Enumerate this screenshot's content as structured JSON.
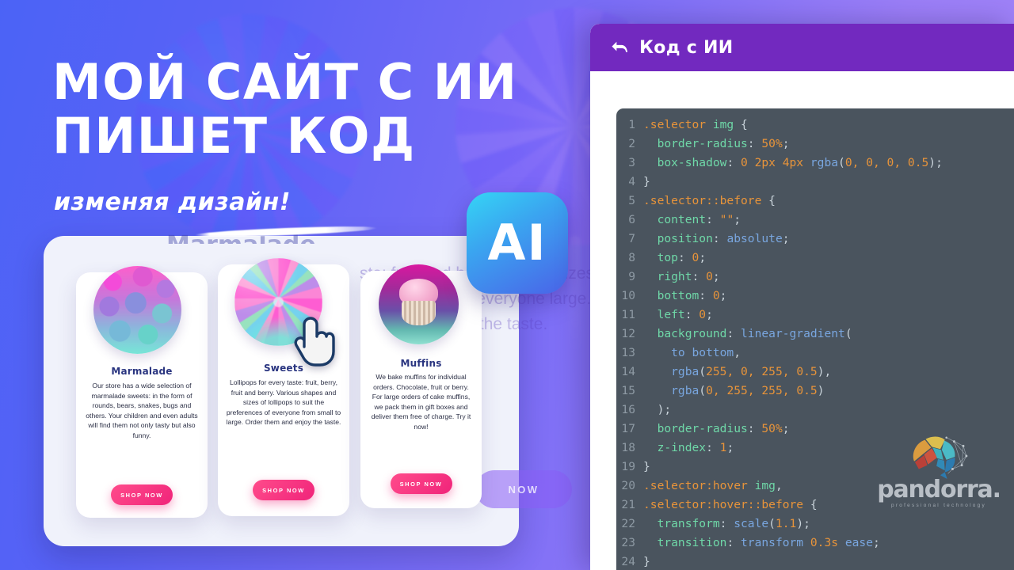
{
  "headline": {
    "line1": "МОЙ САЙТ С ИИ",
    "line2": "ПИШЕТ КОД",
    "subline": "изменяя дизайн!"
  },
  "ai_badge": {
    "label": "AI"
  },
  "ghost": {
    "title": "Marmalade",
    "text": "ste: fruit and berry. es and sizes of to suit the of everyone large. Order joy the taste.",
    "button": "NOW"
  },
  "cards": [
    {
      "title": "Marmalade",
      "body": "Our store has a wide selection of marmalade sweets: in the form of rounds, bears, snakes, bugs and others. Your children and even adults will find them not only tasty but also funny.",
      "button": "SHOP NOW",
      "thumb": "marmalade-photo"
    },
    {
      "title": "Sweets",
      "body": "Lollipops for every taste: fruit, berry, fruit and berry. Various shapes and sizes of lollipops to suit the preferences of everyone from small to large. Order them and enjoy the taste.",
      "button": "SHOP NOW",
      "thumb": "lollipop-photo"
    },
    {
      "title": "Muffins",
      "body": "We bake muffins for individual orders. Chocolate, fruit or berry. For large orders of cake muffins, we pack them in gift boxes and deliver them free of charge. Try it now!",
      "button": "SHOP NOW",
      "thumb": "muffin-photo"
    }
  ],
  "code_panel": {
    "header_title": "Код с ИИ",
    "back_icon": "back-arrow-icon",
    "lines": [
      {
        "n": "1",
        "parts": [
          {
            "t": ".selector",
            "c": "tok-sel"
          },
          {
            "t": " img",
            "c": "tok-prop"
          },
          {
            "t": " {",
            "c": "tok-punc"
          }
        ]
      },
      {
        "n": "2",
        "parts": [
          {
            "t": "  border-radius",
            "c": "tok-prop"
          },
          {
            "t": ": ",
            "c": "tok-punc"
          },
          {
            "t": "50%",
            "c": "tok-num"
          },
          {
            "t": ";",
            "c": "tok-punc"
          }
        ]
      },
      {
        "n": "3",
        "parts": [
          {
            "t": "  box-shadow",
            "c": "tok-prop"
          },
          {
            "t": ": ",
            "c": "tok-punc"
          },
          {
            "t": "0 2px 4px ",
            "c": "tok-num"
          },
          {
            "t": "rgba",
            "c": "tok-fn"
          },
          {
            "t": "(",
            "c": "tok-punc"
          },
          {
            "t": "0, 0, 0, 0.5",
            "c": "tok-num"
          },
          {
            "t": ");",
            "c": "tok-punc"
          }
        ]
      },
      {
        "n": "4",
        "parts": [
          {
            "t": "}",
            "c": "tok-punc"
          }
        ]
      },
      {
        "n": "5",
        "parts": [
          {
            "t": ".selector",
            "c": "tok-sel"
          },
          {
            "t": "::before",
            "c": "tok-sel"
          },
          {
            "t": " {",
            "c": "tok-punc"
          }
        ]
      },
      {
        "n": "6",
        "parts": [
          {
            "t": "  content",
            "c": "tok-prop"
          },
          {
            "t": ": ",
            "c": "tok-punc"
          },
          {
            "t": "\"\"",
            "c": "tok-str"
          },
          {
            "t": ";",
            "c": "tok-punc"
          }
        ]
      },
      {
        "n": "7",
        "parts": [
          {
            "t": "  position",
            "c": "tok-prop"
          },
          {
            "t": ": ",
            "c": "tok-punc"
          },
          {
            "t": "absolute",
            "c": "tok-kw"
          },
          {
            "t": ";",
            "c": "tok-punc"
          }
        ]
      },
      {
        "n": "8",
        "parts": [
          {
            "t": "  top",
            "c": "tok-prop"
          },
          {
            "t": ": ",
            "c": "tok-punc"
          },
          {
            "t": "0",
            "c": "tok-num"
          },
          {
            "t": ";",
            "c": "tok-punc"
          }
        ]
      },
      {
        "n": "9",
        "parts": [
          {
            "t": "  right",
            "c": "tok-prop"
          },
          {
            "t": ": ",
            "c": "tok-punc"
          },
          {
            "t": "0",
            "c": "tok-num"
          },
          {
            "t": ";",
            "c": "tok-punc"
          }
        ]
      },
      {
        "n": "10",
        "parts": [
          {
            "t": "  bottom",
            "c": "tok-prop"
          },
          {
            "t": ": ",
            "c": "tok-punc"
          },
          {
            "t": "0",
            "c": "tok-num"
          },
          {
            "t": ";",
            "c": "tok-punc"
          }
        ]
      },
      {
        "n": "11",
        "parts": [
          {
            "t": "  left",
            "c": "tok-prop"
          },
          {
            "t": ": ",
            "c": "tok-punc"
          },
          {
            "t": "0",
            "c": "tok-num"
          },
          {
            "t": ";",
            "c": "tok-punc"
          }
        ]
      },
      {
        "n": "12",
        "parts": [
          {
            "t": "  background",
            "c": "tok-prop"
          },
          {
            "t": ": ",
            "c": "tok-punc"
          },
          {
            "t": "linear-gradient",
            "c": "tok-fn"
          },
          {
            "t": "(",
            "c": "tok-punc"
          }
        ]
      },
      {
        "n": "13",
        "parts": [
          {
            "t": "    to bottom",
            "c": "tok-kw"
          },
          {
            "t": ",",
            "c": "tok-punc"
          }
        ]
      },
      {
        "n": "14",
        "parts": [
          {
            "t": "    rgba",
            "c": "tok-fn"
          },
          {
            "t": "(",
            "c": "tok-punc"
          },
          {
            "t": "255, 0, 255, 0.5",
            "c": "tok-num"
          },
          {
            "t": "),",
            "c": "tok-punc"
          }
        ]
      },
      {
        "n": "15",
        "parts": [
          {
            "t": "    rgba",
            "c": "tok-fn"
          },
          {
            "t": "(",
            "c": "tok-punc"
          },
          {
            "t": "0, 255, 255, 0.5",
            "c": "tok-num"
          },
          {
            "t": ")",
            "c": "tok-punc"
          }
        ]
      },
      {
        "n": "16",
        "parts": [
          {
            "t": "  );",
            "c": "tok-punc"
          }
        ]
      },
      {
        "n": "17",
        "parts": [
          {
            "t": "  border-radius",
            "c": "tok-prop"
          },
          {
            "t": ": ",
            "c": "tok-punc"
          },
          {
            "t": "50%",
            "c": "tok-num"
          },
          {
            "t": ";",
            "c": "tok-punc"
          }
        ]
      },
      {
        "n": "18",
        "parts": [
          {
            "t": "  z-index",
            "c": "tok-prop"
          },
          {
            "t": ": ",
            "c": "tok-punc"
          },
          {
            "t": "1",
            "c": "tok-num"
          },
          {
            "t": ";",
            "c": "tok-punc"
          }
        ]
      },
      {
        "n": "19",
        "parts": [
          {
            "t": "}",
            "c": "tok-punc"
          }
        ]
      },
      {
        "n": "20",
        "parts": [
          {
            "t": ".selector",
            "c": "tok-sel"
          },
          {
            "t": ":hover",
            "c": "tok-sel"
          },
          {
            "t": " img",
            "c": "tok-prop"
          },
          {
            "t": ",",
            "c": "tok-punc"
          }
        ]
      },
      {
        "n": "21",
        "parts": [
          {
            "t": ".selector",
            "c": "tok-sel"
          },
          {
            "t": ":hover",
            "c": "tok-sel"
          },
          {
            "t": "::before",
            "c": "tok-sel"
          },
          {
            "t": " {",
            "c": "tok-punc"
          }
        ]
      },
      {
        "n": "22",
        "parts": [
          {
            "t": "  transform",
            "c": "tok-prop"
          },
          {
            "t": ": ",
            "c": "tok-punc"
          },
          {
            "t": "scale",
            "c": "tok-fn"
          },
          {
            "t": "(",
            "c": "tok-punc"
          },
          {
            "t": "1.1",
            "c": "tok-num"
          },
          {
            "t": ");",
            "c": "tok-punc"
          }
        ]
      },
      {
        "n": "23",
        "parts": [
          {
            "t": "  transition",
            "c": "tok-prop"
          },
          {
            "t": ": ",
            "c": "tok-punc"
          },
          {
            "t": "transform ",
            "c": "tok-kw"
          },
          {
            "t": "0.3s",
            "c": "tok-num"
          },
          {
            "t": " ease",
            "c": "tok-kw"
          },
          {
            "t": ";",
            "c": "tok-punc"
          }
        ]
      },
      {
        "n": "24",
        "parts": [
          {
            "t": "}",
            "c": "tok-punc"
          }
        ]
      }
    ]
  },
  "watermark": {
    "word": "pandorra.",
    "tagline": "professional technology",
    "logo": "brain-logo"
  },
  "colors": {
    "bg_left": "#4b63f6",
    "bg_right": "#a285f8",
    "header_purple": "#7229bf",
    "code_bg": "#4a545e",
    "accent_pink": "#f0247a",
    "ai_badge_from": "#35d5f5",
    "ai_badge_to": "#4a63e8"
  }
}
